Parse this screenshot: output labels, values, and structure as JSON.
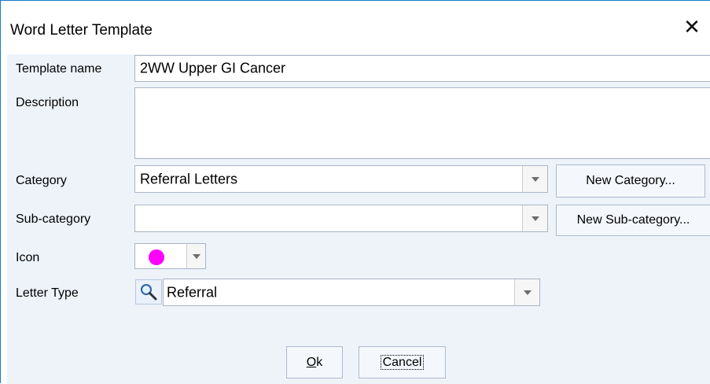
{
  "window": {
    "title": "Word Letter Template",
    "close_symbol": "✕"
  },
  "form": {
    "template_name": {
      "label": "Template name",
      "value": "2WW Upper GI Cancer"
    },
    "description": {
      "label": "Description",
      "value": ""
    },
    "category": {
      "label": "Category",
      "value": "Referral Letters",
      "button": "New Category..."
    },
    "sub_category": {
      "label": "Sub-category",
      "value": "",
      "button": "New Sub-category..."
    },
    "icon": {
      "label": "Icon",
      "color": "#ff00ff"
    },
    "letter_type": {
      "label": "Letter Type",
      "value": "Referral"
    }
  },
  "buttons": {
    "ok": {
      "mnemonic": "O",
      "rest": "k"
    },
    "cancel": {
      "label": "Cancel"
    }
  },
  "icons": {
    "dropdown": "chevron-down-icon",
    "search": "magnifier-icon",
    "close": "close-icon"
  }
}
